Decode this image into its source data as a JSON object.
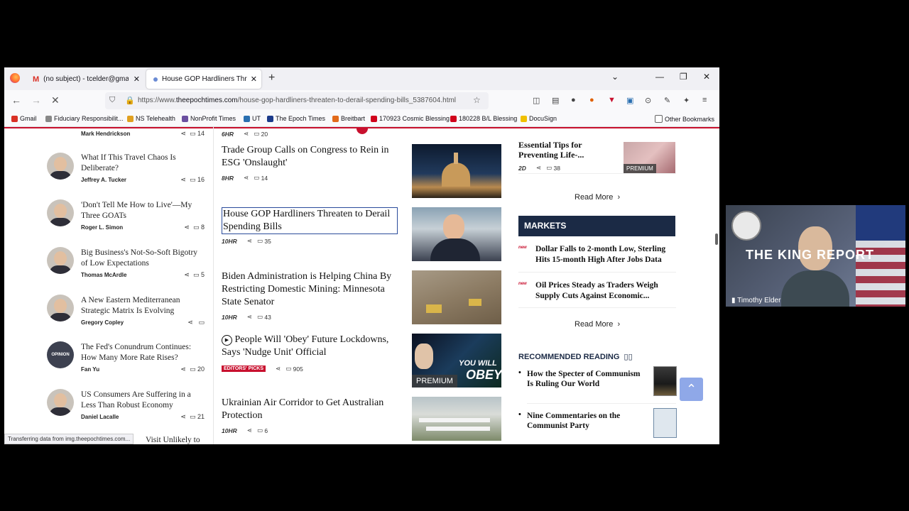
{
  "browser": {
    "tabs": [
      {
        "label": "(no subject) - tcelder@gmail.co",
        "icon": "gmail-icon"
      },
      {
        "label": "House GOP Hardliners Threaten",
        "icon": "loading-dot-icon"
      }
    ],
    "url_prefix": "https://www.",
    "url_domain": "theepochtimes.com",
    "url_path": "/house-gop-hardliners-threaten-to-derail-spending-bills_5387604.html",
    "bookmarks": [
      {
        "label": "Gmail",
        "color": "#d93025"
      },
      {
        "label": "Fiduciary Responsibilit...",
        "color": "#888888"
      },
      {
        "label": "NS Telehealth",
        "color": "#e0a020"
      },
      {
        "label": "NonProfit Times",
        "color": "#6b4fa0"
      },
      {
        "label": "UT",
        "color": "#2a6fb0"
      },
      {
        "label": "The Epoch Times",
        "color": "#1b3a8a"
      },
      {
        "label": "Breitbart",
        "color": "#e26a1a"
      },
      {
        "label": "170923 Cosmic Blessing",
        "color": "#d0021b"
      },
      {
        "label": "180228 B/L Blessing",
        "color": "#d0021b"
      },
      {
        "label": "DocuSign",
        "color": "#f0c000"
      }
    ],
    "other_bookmarks": "Other Bookmarks",
    "status": "Transferring data from img.theepochtimes.com..."
  },
  "left_column": {
    "top_author": "Mark Hendrickson",
    "top_comments": "14",
    "items": [
      {
        "title": "What If This Travel Chaos Is Deliberate?",
        "author": "Jeffrey A. Tucker",
        "comments": "16"
      },
      {
        "title": "'Don't Tell Me How to Live'—My Three GOATs",
        "author": "Roger L. Simon",
        "comments": "8"
      },
      {
        "title": "Big Business's Not-So-Soft Bigotry of Low Expectations",
        "author": "Thomas McArdle",
        "comments": "5"
      },
      {
        "title": "A New Eastern Mediterranean Strategic Matrix Is Evolving",
        "author": "Gregory Copley",
        "comments": ""
      },
      {
        "title": "The Fed's Conundrum Continues: How Many More Rate Rises?",
        "author": "Fan Yu",
        "comments": "20",
        "avatar_text": "OPINION"
      },
      {
        "title": "US Consumers Are Suffering in a Less Than Robust Economy",
        "author": "Daniel Lacalle",
        "comments": "21"
      }
    ],
    "partial_title": "Visit Unlikely to"
  },
  "middle_column": {
    "top_time": "6HR",
    "top_comments": "20",
    "items": [
      {
        "title": "Trade Group Calls on Congress to Rein in ESG 'Onslaught'",
        "time": "8HR",
        "comments": "14"
      },
      {
        "title": "House GOP Hardliners Threaten to Derail Spending Bills",
        "time": "10HR",
        "comments": "35"
      },
      {
        "title": "Biden Administration is Helping China By Restricting Domestic Mining: Minnesota State Senator",
        "time": "10HR",
        "comments": "43"
      },
      {
        "title": "People Will 'Obey' Future Lockdowns, Says 'Nudge Unit' Official",
        "time": "EDITORS' PICKS",
        "comments": "905",
        "badge": "PREMIUM",
        "thumb_text1": "YOU WILL",
        "thumb_text2": "OBEY"
      },
      {
        "title": "Ukrainian Air Corridor to Get Australian Protection",
        "time": "10HR",
        "comments": "6"
      }
    ]
  },
  "right_column": {
    "top_title": "Essential Tips for Preventing Life-...",
    "top_time": "2D",
    "top_comments": "38",
    "top_badge": "PREMIUM",
    "read_more": "Read More",
    "markets_header": "MARKETS",
    "new_tag": "new",
    "markets": [
      "Dollar Falls to 2-month Low, Sterling Hits 15-month High After Jobs Data",
      "Oil Prices Steady as Traders Weigh Supply Cuts Against Economic..."
    ],
    "recommended_header": "RECOMMENDED READING",
    "recommended": [
      "How the Specter of Communism Is Ruling Our World",
      "Nine Commentaries on the Communist Party"
    ]
  },
  "webcam": {
    "title": "THE KING REPORT",
    "name": "Timothy Elder"
  }
}
